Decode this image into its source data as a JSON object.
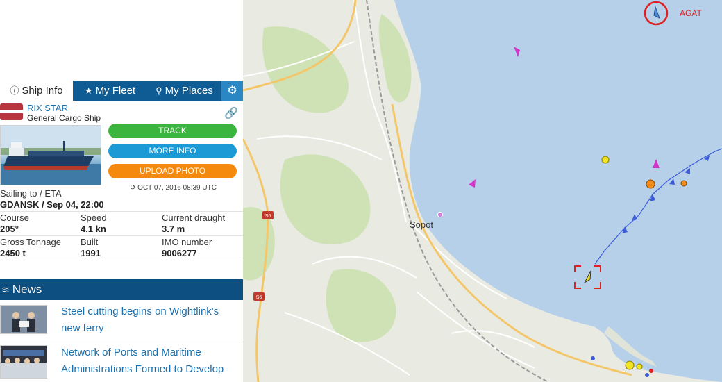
{
  "tabs": {
    "ship_info": "Ship Info",
    "my_fleet": "My Fleet",
    "my_places": "My Places"
  },
  "ship": {
    "name": "RIX STAR",
    "type": "General Cargo Ship",
    "photo_date": "OCT 07, 2016 08:39 UTC"
  },
  "buttons": {
    "track": "TRACK",
    "more_info": "MORE INFO",
    "upload_photo": "UPLOAD PHOTO"
  },
  "voyage": {
    "label": "Sailing to / ETA",
    "value": "GDANSK / Sep 04, 22:00"
  },
  "details": {
    "course_label": "Course",
    "course_value": "205°",
    "speed_label": "Speed",
    "speed_value": "4.1 kn",
    "draught_label": "Current draught",
    "draught_value": "3.7 m",
    "gt_label": "Gross Tonnage",
    "gt_value": "2450 t",
    "built_label": "Built",
    "built_value": "1991",
    "imo_label": "IMO number",
    "imo_value": "9006277"
  },
  "news": {
    "title": "News",
    "items": [
      {
        "text": "Steel cutting begins on Wightlink's new ferry"
      },
      {
        "text": "Network of Ports and Maritime Administrations Formed to Develop"
      }
    ]
  },
  "map": {
    "labels": {
      "town": "Sopot",
      "vessel": "AGAT",
      "road_1": "S6",
      "road_2": "S6"
    },
    "colors": {
      "sea": "#b6d0ea",
      "land": "#e9ebe3",
      "park": "#cfe2b5",
      "road_major": "#f4c66a",
      "track": "#3b5bd8",
      "highlight": "#e02020"
    }
  }
}
